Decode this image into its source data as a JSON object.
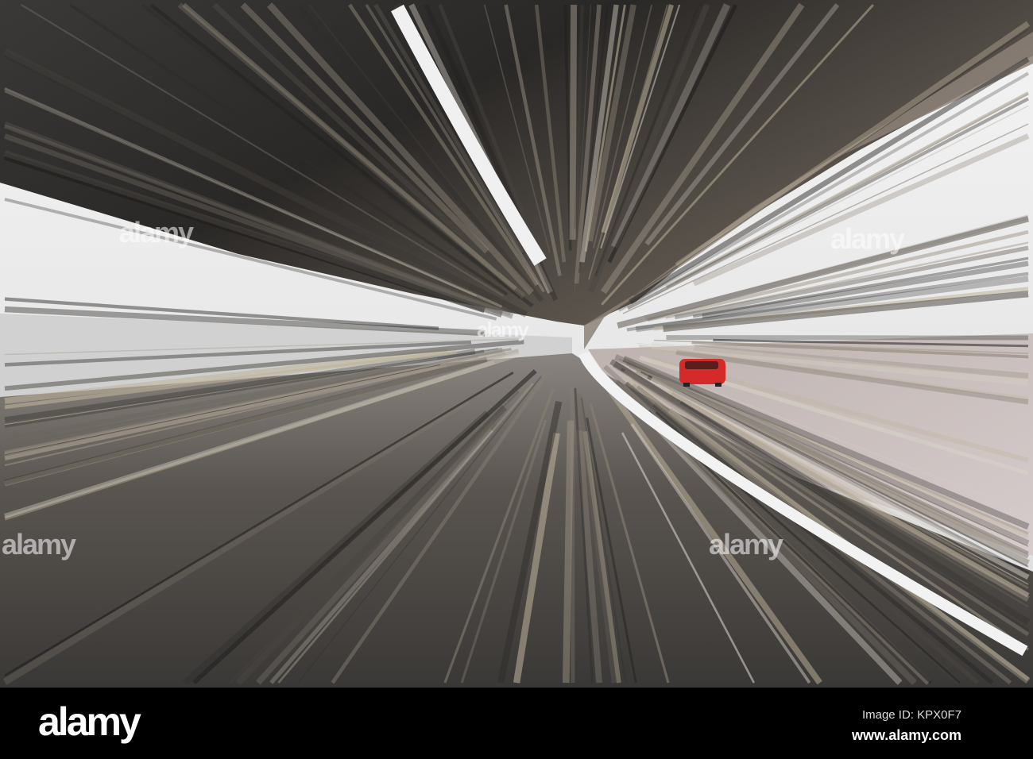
{
  "photo": {
    "subject": "motion-blurred elevated train track curving through a tunnel-like overpass",
    "car_color": "#d42a2a"
  },
  "watermark": {
    "text": "alamy"
  },
  "footer": {
    "logo": "alamy",
    "image_id": "Image ID: KPX0F7",
    "website": "www.alamy.com"
  }
}
